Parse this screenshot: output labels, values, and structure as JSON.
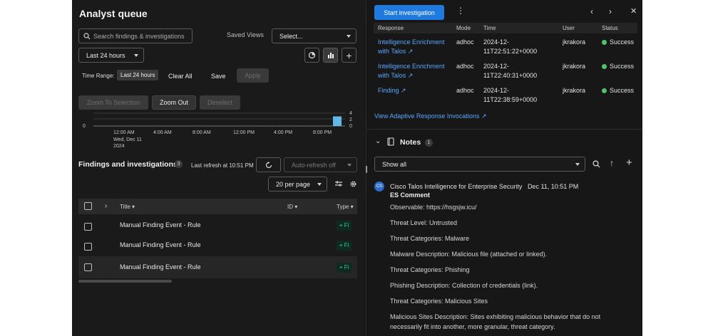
{
  "left": {
    "title": "Analyst queue",
    "search_placeholder": "Search findings & investigations",
    "saved_views_label": "Saved Views",
    "saved_views_value": "Select...",
    "time_filter": "Last 24 hours",
    "time_range_label": "Time Range:",
    "time_range_value": "Last 24 hours",
    "clear_all": "Clear All",
    "save": "Save",
    "apply": "Apply",
    "zoom_to_selection": "Zoom To Selection",
    "zoom_out": "Zoom Out",
    "deselect": "Deselect",
    "timeline": {
      "y_ticks": [
        "4",
        "2",
        "0"
      ],
      "left_zero": "0",
      "x_ticks": [
        "12:00 AM",
        "4:00 AM",
        "8:00 AM",
        "12:00 PM",
        "4:00 PM",
        "8:00 PM"
      ],
      "date_line1": "Wed, Dec 11",
      "date_line2": "2024",
      "bar_fraction_of_max": 0.75
    },
    "findings_title": "Findings and investigations",
    "findings_count": "3",
    "last_refresh": "Last refresh at 10:51 PM",
    "auto_refresh": "Auto-refresh off",
    "per_page": "20 per page",
    "columns": {
      "title": "Title",
      "id": "ID",
      "type": "Type"
    },
    "rows": [
      {
        "title": "Manual Finding Event - Rule",
        "type": "Fi"
      },
      {
        "title": "Manual Finding Event - Rule",
        "type": "Fi"
      },
      {
        "title": "Manual Finding Event - Rule",
        "type": "Fi"
      }
    ]
  },
  "right": {
    "start_investigation": "Start investigation",
    "columns": {
      "response": "Response",
      "mode": "Mode",
      "time": "Time",
      "user": "User",
      "status": "Status"
    },
    "invocations": [
      {
        "response_l1": "Intelligence Enrichment",
        "response_l2": "with Talos",
        "mode": "adhoc",
        "time_l1": "2024-12-",
        "time_l2": "11T22:51:22+0000",
        "user": "jkrakora",
        "status": "Success"
      },
      {
        "response_l1": "Intelligence Enrichment",
        "response_l2": "with Talos",
        "mode": "adhoc",
        "time_l1": "2024-12-",
        "time_l2": "11T22:40:31+0000",
        "user": "jkrakora",
        "status": "Success"
      },
      {
        "response_l1": "Finding",
        "response_l2": "",
        "mode": "adhoc",
        "time_l1": "2024-12-",
        "time_l2": "11T22:38:59+0000",
        "user": "jkrakora",
        "status": "Success"
      }
    ],
    "view_invocations": "View Adaptive Response Invocations",
    "notes_title": "Notes",
    "notes_count": "1",
    "show_filter": "Show all",
    "note": {
      "avatar": "CS",
      "author": "Cisco Talos Intelligence for Enterprise Security",
      "date": "Dec 11, 10:51 PM",
      "heading": "ES Comment",
      "lines": [
        "Observable: https://hsgsjw.icu/",
        "Threat Level: Untrusted",
        "Threat Categories: Malware",
        "Malware Description: Malicious file (attached or linked).",
        "Threat Categories: Phishing",
        "Phishing Description: Collection of credentials (link).",
        "Threat Categories: Malicious Sites",
        "Malicious Sites Description: Sites exhibiting malicious behavior that do not",
        "necessarily fit into another, more granular, threat category."
      ]
    }
  }
}
